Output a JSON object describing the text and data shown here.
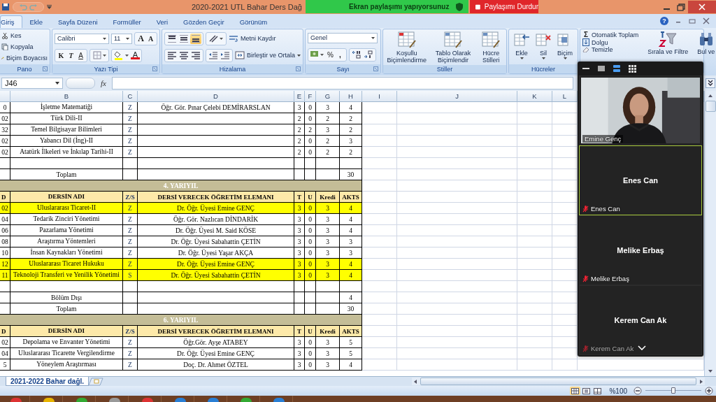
{
  "title_bar": {
    "title": "2020-2021 UTL Bahar Ders Dağ"
  },
  "share_banner": {
    "status": "Ekran paylaşımı yapıyorsunuz",
    "stop": "Paylaşımı Durdur"
  },
  "tabs": [
    {
      "label": "Giriş",
      "selected": true
    },
    {
      "label": "Ekle",
      "selected": false
    },
    {
      "label": "Sayfa Düzeni",
      "selected": false
    },
    {
      "label": "Formüller",
      "selected": false
    },
    {
      "label": "Veri",
      "selected": false
    },
    {
      "label": "Gözden Geçir",
      "selected": false
    },
    {
      "label": "Görünüm",
      "selected": false
    }
  ],
  "help": "?",
  "ribbon": {
    "clipboard": {
      "label": "Pano",
      "cut": "Kes",
      "copy": "Kopyala",
      "painter": "Biçim Boyacısı"
    },
    "font": {
      "label": "Yazı Tipi",
      "family": "Calibri",
      "size": "11",
      "grow": "A",
      "shrink": "A",
      "bold": "K",
      "italic": "T",
      "underline": "A",
      "font_color": "A"
    },
    "alignment": {
      "label": "Hizalama",
      "wrap": "Metni Kaydır",
      "merge": "Birleştir ve Ortala",
      "vertical": [
        {
          "selected": false
        },
        {
          "selected": false
        },
        {
          "selected": true
        }
      ]
    },
    "number": {
      "label": "Sayı",
      "format": "Genel",
      "percent": "%",
      "comma": ","
    },
    "styles": {
      "label": "Stiller",
      "buttons": [
        "Koşullu Biçimlendirme",
        "Tablo Olarak Biçimlendir",
        "Hücre Stilleri"
      ]
    },
    "cells": {
      "label": "Hücreler",
      "buttons": [
        "Ekle",
        "Sil",
        "Biçim"
      ]
    },
    "editing": {
      "sigma": "Σ",
      "autosum": "Otomatik Toplam",
      "fill": "Dolgu",
      "clear": "Temizle",
      "sort": "Sırala ve Filtre",
      "find": "Bul ve"
    }
  },
  "formula_bar": {
    "cell": "J46",
    "fx": "fx"
  },
  "sheet": {
    "columns": [
      "B",
      "C",
      "D",
      "E",
      "F",
      "G",
      "H",
      "I",
      "J",
      "K",
      "L"
    ],
    "rows": [
      {
        "kind": "course",
        "code": "0",
        "name": "İşletme Matematiği",
        "type": "Z",
        "teacher": "Öğr. Gör. Pınar Çelebi DEMİRARSLAN",
        "t": "3",
        "u": "0",
        "credit": "3",
        "ects": "4",
        "highlighted": false
      },
      {
        "kind": "course",
        "code": "02",
        "name": "Türk Dili-II",
        "type": "Z",
        "t": "2",
        "u": "0",
        "credit": "2",
        "ects": "2",
        "highlighted": false
      },
      {
        "kind": "course",
        "code": "32",
        "name": "Temel Bilgisayar Bilimleri",
        "type": "Z",
        "t": "2",
        "u": "2",
        "credit": "3",
        "ects": "2",
        "highlighted": false
      },
      {
        "kind": "course",
        "code": "02",
        "name": "Yabancı Dil (İng)-II",
        "type": "Z",
        "t": "2",
        "u": "0",
        "credit": "2",
        "ects": "3",
        "highlighted": false
      },
      {
        "kind": "course",
        "code": "02",
        "name": "Atatürk İlkeleri ve İnkılap Tarihi-II",
        "type": "Z",
        "t": "2",
        "u": "0",
        "credit": "2",
        "ects": "2",
        "highlighted": false
      },
      {
        "kind": "blank"
      },
      {
        "kind": "total",
        "label": "Toplam",
        "ects": "30"
      },
      {
        "kind": "section",
        "label": "4. YARIYIL"
      },
      {
        "kind": "header",
        "code": "D",
        "name": "DERSİN ADI",
        "type": "Z/S",
        "teacher": "DERSİ VERECEK ÖĞRETİM ELEMANI",
        "t": "T",
        "u": "U",
        "credit": "Kredi",
        "ects": "AKTS"
      },
      {
        "kind": "course",
        "code": "02",
        "name": "Uluslararası Ticaret-II",
        "type": "Z",
        "teacher": "Dr. Öğr. Üyesi Emine GENÇ",
        "t": "3",
        "u": "0",
        "credit": "3",
        "ects": "4",
        "highlighted": true
      },
      {
        "kind": "course",
        "code": "04",
        "name": "Tedarik Zinciri Yönetimi",
        "type": "Z",
        "teacher": "Öğr. Gör. Nazlıcan DİNDARİK",
        "t": "3",
        "u": "0",
        "credit": "3",
        "ects": "4",
        "highlighted": false
      },
      {
        "kind": "course",
        "code": "06",
        "name": "Pazarlama Yönetimi",
        "type": "Z",
        "teacher": "Dr. Öğr. Üyesi M. Said KÖSE",
        "t": "3",
        "u": "0",
        "credit": "3",
        "ects": "4",
        "highlighted": false
      },
      {
        "kind": "course",
        "code": "08",
        "name": "Araştırma Yöntemleri",
        "type": "Z",
        "teacher": "Dr. Öğr. Üyesi Sabahattin ÇETİN",
        "t": "3",
        "u": "0",
        "credit": "3",
        "ects": "3",
        "highlighted": false
      },
      {
        "kind": "course",
        "code": "10",
        "name": "İnsan Kaynakları Yönetimi",
        "type": "Z",
        "teacher": "Dr. Öğr. Üyesi Yaşar AKÇA",
        "t": "3",
        "u": "0",
        "credit": "3",
        "ects": "3",
        "highlighted": false
      },
      {
        "kind": "course",
        "code": "12",
        "name": "Uluslararası Ticaret Hukuku",
        "type": "Z",
        "teacher": "Dr. Öğr. Üyesi Emine GENÇ",
        "t": "3",
        "u": "0",
        "credit": "3",
        "ects": "4",
        "highlighted": true
      },
      {
        "kind": "course",
        "code": "11",
        "name": "Teknoloji Transferi ve Yenilik Yönetimi",
        "type": "S",
        "teacher": "Dr. Öğr. Üyesi Sabahattin ÇETİN",
        "t": "3",
        "u": "0",
        "credit": "3",
        "ects": "4",
        "highlighted": true
      },
      {
        "kind": "blank"
      },
      {
        "kind": "total",
        "label": "Bölüm Dışı",
        "ects": "4"
      },
      {
        "kind": "total",
        "label": "Toplam",
        "ects": "30"
      },
      {
        "kind": "section",
        "label": "6. YARIYIL"
      },
      {
        "kind": "header",
        "code": "D",
        "name": "DERSİN ADI",
        "type": "Z/S",
        "teacher": "DERSİ VERECEK ÖĞRETİM ELEMANI",
        "t": "T",
        "u": "U",
        "credit": "Kredi",
        "ects": "AKTS"
      },
      {
        "kind": "course",
        "code": "02",
        "name": "Depolama ve Envanter Yönetimi",
        "type": "Z",
        "teacher": "Öğr.Gör. Ayşe ATABEY",
        "t": "3",
        "u": "0",
        "credit": "3",
        "ects": "5",
        "highlighted": false
      },
      {
        "kind": "course",
        "code": "04",
        "name": "Uluslararası Ticarette Vergilendirme",
        "type": "Z",
        "teacher": "Dr. Öğr. Üyesi Emine GENÇ",
        "t": "3",
        "u": "0",
        "credit": "3",
        "ects": "5",
        "highlighted": false
      },
      {
        "kind": "course",
        "code": "5",
        "name": "Yöneylem Araştırması",
        "type": "Z",
        "teacher": "Doç. Dr. Ahmet ÖZTEL",
        "t": "3",
        "u": "0",
        "credit": "3",
        "ects": "4",
        "highlighted": false
      }
    ]
  },
  "sheet_tab": {
    "label": "2021-2022 Bahar dağl."
  },
  "status_bar": {
    "views": [
      {
        "selected": true
      },
      {
        "selected": false
      },
      {
        "selected": false
      }
    ],
    "zoom": "%100",
    "level": 0.5
  },
  "meeting": {
    "layouts": [
      {
        "selected": false
      },
      {
        "selected": false
      },
      {
        "selected": true
      },
      {
        "selected": false
      }
    ],
    "participants": [
      {
        "kind": "video",
        "label": "Emine Genç",
        "muted": false,
        "speaking": false
      },
      {
        "kind": "name",
        "title": "Enes Can",
        "label": "Enes Can",
        "muted": true,
        "speaking": true
      },
      {
        "kind": "name",
        "title": "Melike Erbaş",
        "label": "Melike Erbaş",
        "muted": true,
        "speaking": false
      },
      {
        "kind": "name",
        "title": "Kerem Can Ak",
        "label": "Kerem Can Ak",
        "muted": true,
        "speaking": false
      }
    ]
  }
}
